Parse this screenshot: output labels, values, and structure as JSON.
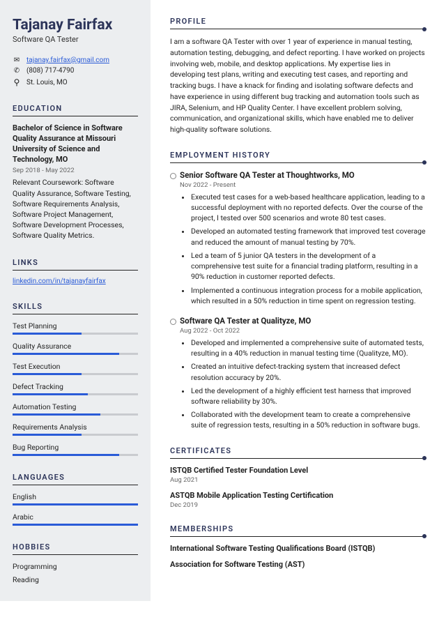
{
  "name": "Tajanay Fairfax",
  "title": "Software QA Tester",
  "contact": {
    "email": "tajanay.fairfax@gmail.com",
    "phone": "(808) 717-4790",
    "location": "St. Louis, MO"
  },
  "headings": {
    "education": "EDUCATION",
    "links": "LINKS",
    "skills": "SKILLS",
    "languages": "LANGUAGES",
    "hobbies": "HOBBIES",
    "profile": "PROFILE",
    "employment": "EMPLOYMENT HISTORY",
    "certificates": "CERTIFICATES",
    "memberships": "MEMBERSHIPS"
  },
  "education": {
    "degree": "Bachelor of Science in Software Quality Assurance at Missouri University of Science and Technology, MO",
    "dates": "Sep 2018 - May 2022",
    "coursework": "Relevant Coursework: Software Quality Assurance, Software Testing, Software Requirements Analysis, Software Project Management, Software Development Processes, Software Quality Metrics."
  },
  "links": {
    "linkedin": "linkedin.com/in/tajanayfairfax"
  },
  "skills": [
    {
      "name": "Test Planning",
      "level": 55
    },
    {
      "name": "Quality Assurance",
      "level": 85
    },
    {
      "name": "Test Execution",
      "level": 55
    },
    {
      "name": "Defect Tracking",
      "level": 60
    },
    {
      "name": "Automation Testing",
      "level": 70
    },
    {
      "name": "Requirements Analysis",
      "level": 55
    },
    {
      "name": "Bug Reporting",
      "level": 85
    }
  ],
  "languages": [
    {
      "name": "English",
      "level": 100
    },
    {
      "name": "Arabic",
      "level": 100
    }
  ],
  "hobbies": [
    "Programming",
    "Reading"
  ],
  "profile": "I am a software QA Tester with over 1 year of experience in manual testing, automation testing, debugging, and defect reporting. I have worked on projects involving web, mobile, and desktop applications. My expertise lies in developing test plans, writing and executing test cases, and reporting and tracking bugs. I have a knack for finding and isolating software defects and have experience in using different bug tracking and automation tools such as JIRA, Selenium, and HP Quality Center. I have excellent problem solving, communication, and organizational skills, which have enabled me to deliver high-quality software solutions.",
  "jobs": [
    {
      "title": "Senior Software QA Tester at Thoughtworks, MO",
      "dates": "Nov 2022 - Present",
      "bullets": [
        "Executed test cases for a web-based healthcare application, leading to a successful deployment with no reported defects. Over the course of the project, I tested over 500 scenarios and wrote 80 test cases.",
        "Developed an automated testing framework that improved test coverage and reduced the amount of manual testing by 70%.",
        "Led a team of 5 junior QA testers in the development of a comprehensive test suite for a financial trading platform, resulting in a 90% reduction in customer reported defects.",
        "Implemented a continuous integration process for a mobile application, which resulted in a 50% reduction in time spent on regression testing."
      ]
    },
    {
      "title": "Software QA Tester at Qualityze, MO",
      "dates": "Aug 2022 - Oct 2022",
      "bullets": [
        "Developed and implemented a comprehensive suite of automated tests, resulting in a 40% reduction in manual testing time (Qualityze, MO).",
        "Created an intuitive defect-tracking system that increased defect resolution accuracy by 20%.",
        "Led the development of a highly efficient test harness that improved software reliability by 30%.",
        "Collaborated with the development team to create a comprehensive suite of regression tests, resulting in a 50% reduction in software bugs."
      ]
    }
  ],
  "certificates": [
    {
      "title": "ISTQB Certified Tester Foundation Level",
      "date": "Aug 2021"
    },
    {
      "title": "ASTQB Mobile Application Testing Certification",
      "date": "Dec 2019"
    }
  ],
  "memberships": [
    "International Software Testing Qualifications Board (ISTQB)",
    "Association for Software Testing (AST)"
  ]
}
